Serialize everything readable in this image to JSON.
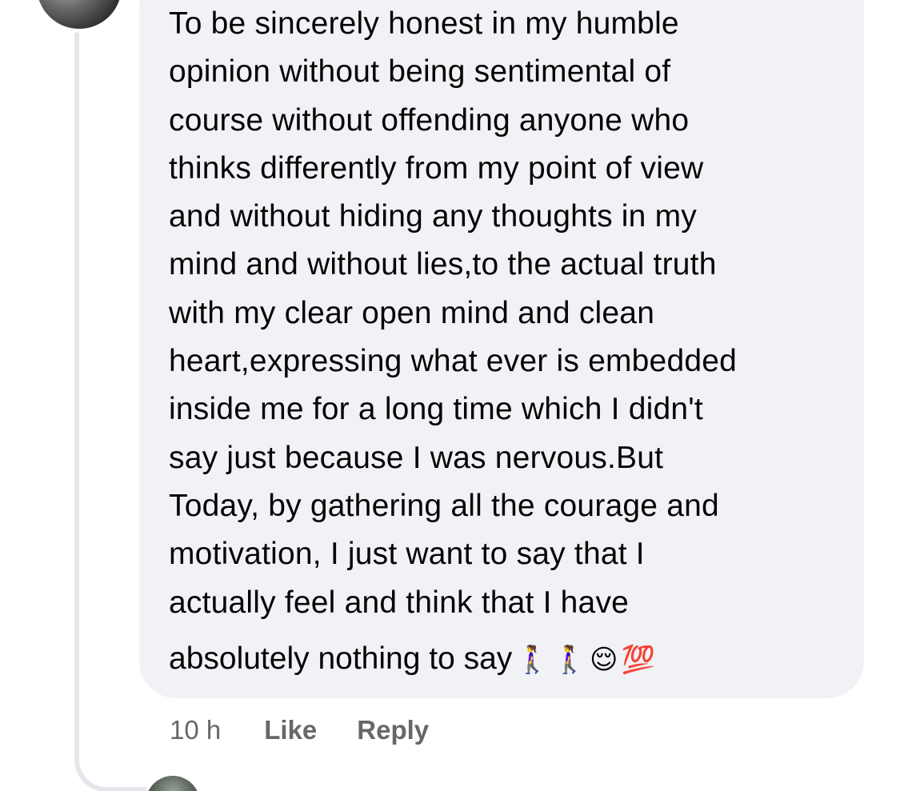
{
  "comment": {
    "lines": [
      "To be sincerely honest in my humble",
      "opinion without being sentimental of",
      "course without offending anyone who",
      "thinks differently from my point of view",
      "and without hiding any thoughts in my",
      "mind and without lies,to the actual truth",
      "with my clear open mind and clean",
      "heart,expressing what ever is embedded",
      "inside me for a long time which I didn't",
      "say just because I was nervous.But",
      "Today, by gathering all the courage and",
      "motivation, I just want to say that I",
      "actually feel and think that I  have"
    ],
    "last_line_text": "absolutely nothing to say",
    "emojis": [
      "🚶‍♀️",
      "🚶‍♀️",
      "😌",
      "💯"
    ]
  },
  "footer": {
    "timestamp": "10 h",
    "like_label": "Like",
    "reply_label": "Reply"
  },
  "colors": {
    "bubble_bg": "#f0f2f5",
    "text": "#050505",
    "meta": "#65676b",
    "thread_line": "#e4e6eb"
  }
}
